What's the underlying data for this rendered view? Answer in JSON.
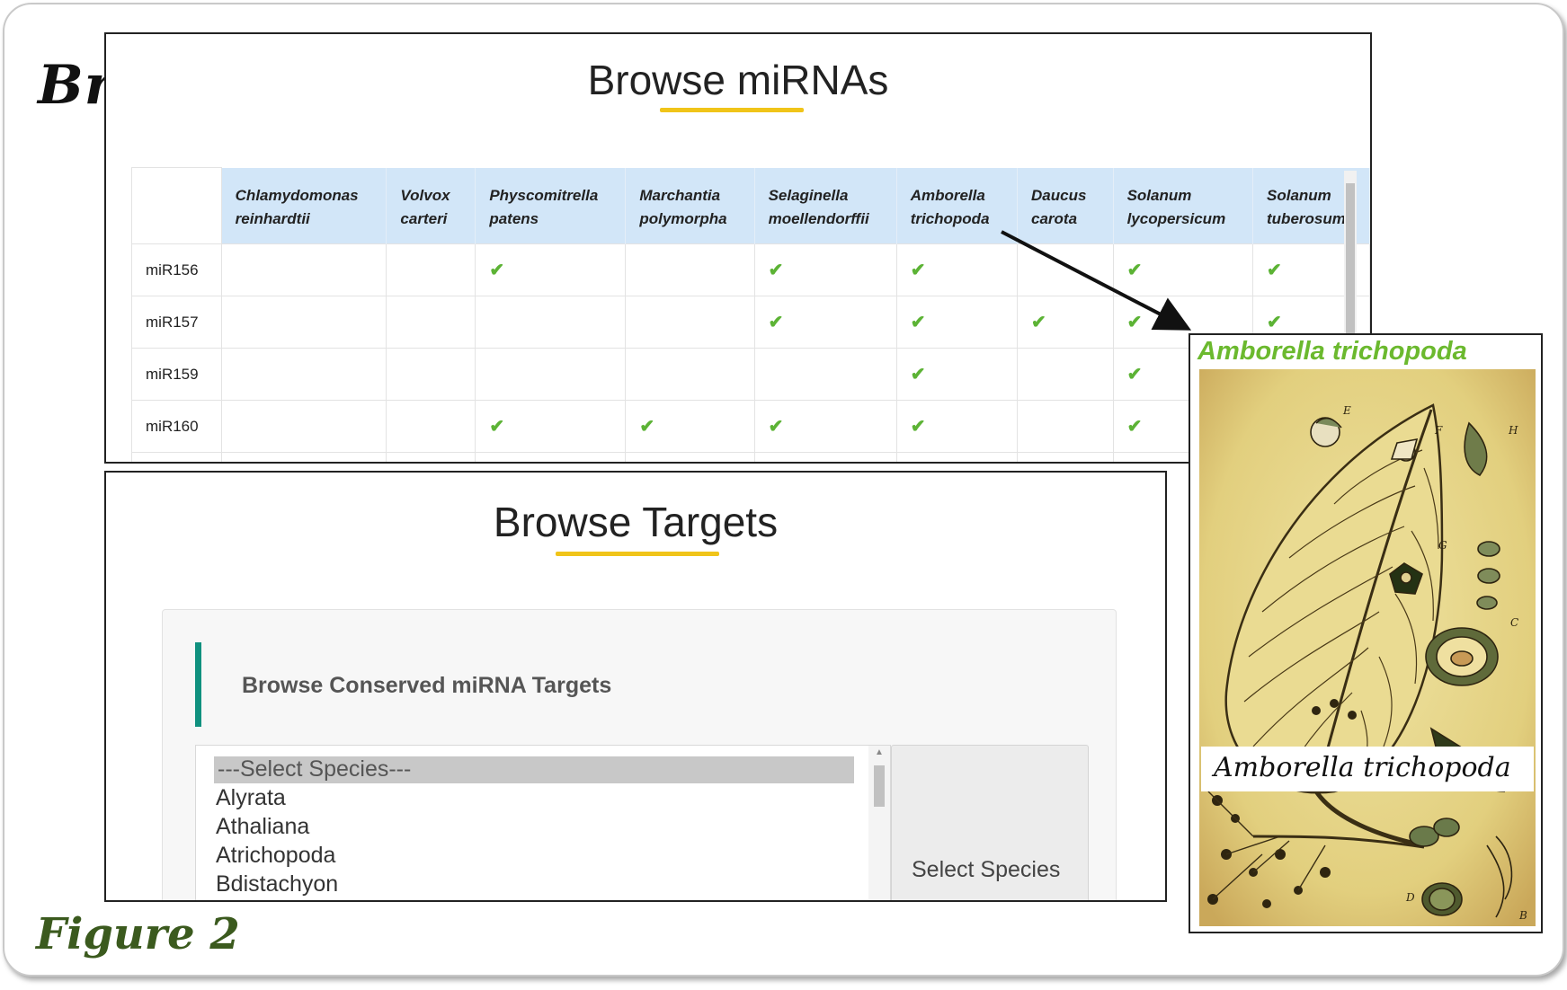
{
  "header": {
    "browse": "Browse",
    "figure": "Figure 2"
  },
  "mirna_panel": {
    "title": "Browse miRNAs",
    "columns": [
      [
        "Chlamydomonas",
        "reinhardtii"
      ],
      [
        "Volvox",
        "carteri"
      ],
      [
        "Physcomitrella",
        "patens"
      ],
      [
        "Marchantia",
        "polymorpha"
      ],
      [
        "Selaginella",
        "moellendorffii"
      ],
      [
        "Amborella",
        "trichopoda"
      ],
      [
        "Daucus",
        "carota"
      ],
      [
        "Solanum",
        "lycopersicum"
      ],
      [
        "Solanum",
        "tuberosum"
      ]
    ],
    "rows": [
      {
        "name": "miR156",
        "present": [
          false,
          false,
          true,
          false,
          true,
          true,
          false,
          true,
          true
        ]
      },
      {
        "name": "miR157",
        "present": [
          false,
          false,
          false,
          false,
          true,
          true,
          true,
          true,
          true
        ]
      },
      {
        "name": "miR159",
        "present": [
          false,
          false,
          false,
          false,
          false,
          true,
          false,
          true,
          false
        ]
      },
      {
        "name": "miR160",
        "present": [
          false,
          false,
          true,
          true,
          true,
          true,
          false,
          true,
          false
        ]
      }
    ],
    "check_glyph": "✔"
  },
  "targets_panel": {
    "title": "Browse Targets",
    "section_label": "Browse Conserved miRNA Targets",
    "species_options": [
      "---Select Species---",
      "Alyrata",
      "Athaliana",
      "Atrichopoda",
      "Bdistachyon"
    ],
    "select_button": "Select Species"
  },
  "plant_card": {
    "title": "Amborella trichopoda",
    "caption": "Amborella trichopoda",
    "letters": [
      "E",
      "F",
      "H",
      "G",
      "C",
      "D",
      "B"
    ]
  },
  "colors": {
    "accent_yellow": "#f0c419",
    "header_blue": "#d2e6f8",
    "check_green": "#5cb335",
    "teal": "#10917f",
    "plant_green": "#6bb92e"
  }
}
